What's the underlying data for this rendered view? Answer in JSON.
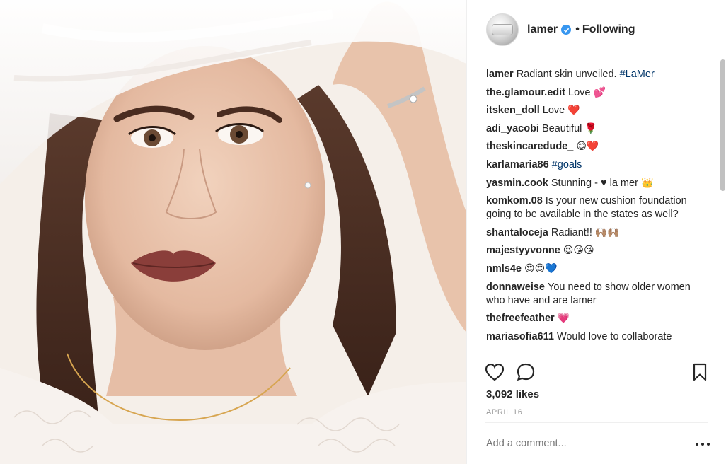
{
  "post": {
    "author": "lamer",
    "follow_status": "Following",
    "dot": "•",
    "photo_description_icon": "portrait-photo"
  },
  "comments": [
    {
      "user": "lamer",
      "text": "Radiant skin unveiled.",
      "hashtag": "#LaMer",
      "emoji": ""
    },
    {
      "user": "the.glamour.edit",
      "text": "Love",
      "hashtag": "",
      "emoji": "💕"
    },
    {
      "user": "itsken_doll",
      "text": "Love",
      "hashtag": "",
      "emoji": "❤️"
    },
    {
      "user": "adi_yacobi",
      "text": "Beautiful",
      "hashtag": "",
      "emoji": "🌹"
    },
    {
      "user": "theskincaredude_",
      "text": "",
      "hashtag": "",
      "emoji": "😊❤️"
    },
    {
      "user": "karlamaria86",
      "text": "",
      "hashtag": "#goals",
      "emoji": ""
    },
    {
      "user": "yasmin.cook",
      "text": "Stunning - ♥ la mer",
      "hashtag": "",
      "emoji": "👑"
    },
    {
      "user": "komkom.08",
      "text": "Is your new cushion foundation going to be available in the states as well?",
      "hashtag": "",
      "emoji": ""
    },
    {
      "user": "shantaloceja",
      "text": "Radiant!!",
      "hashtag": "",
      "emoji": "🙌🏽🙌🏽"
    },
    {
      "user": "majestyyvonne",
      "text": "",
      "hashtag": "",
      "emoji": "😍😘😘"
    },
    {
      "user": "nmls4e",
      "text": "",
      "hashtag": "",
      "emoji": "😍😍💙"
    },
    {
      "user": "donnaweise",
      "text": "You need to show older women who have and are lamer",
      "hashtag": "",
      "emoji": ""
    },
    {
      "user": "thefreefeather",
      "text": "",
      "hashtag": "",
      "emoji": "💗"
    },
    {
      "user": "mariasofia611",
      "text": "Would love to collaborate",
      "hashtag": "",
      "emoji": ""
    }
  ],
  "stats": {
    "likes": "3,092 likes",
    "date": "APRIL 16"
  },
  "composer": {
    "placeholder": "Add a comment..."
  },
  "icons": {
    "like": "heart-icon",
    "comment": "comment-bubble-icon",
    "save": "bookmark-icon",
    "more": "more-options-icon",
    "verified": "verified-badge-icon"
  },
  "colors": {
    "verified": "#3897f0",
    "hashtag": "#003569",
    "text": "#262626",
    "muted": "#999999"
  }
}
